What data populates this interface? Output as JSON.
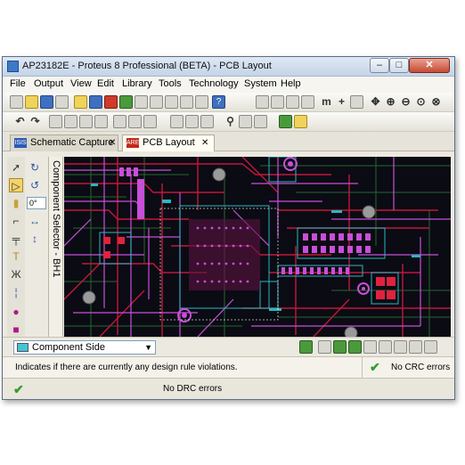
{
  "window": {
    "title": "AP23182E - Proteus 8 Professional (BETA) - PCB Layout",
    "min": "–",
    "max": "□",
    "close": "✕"
  },
  "menu": [
    "File",
    "Output",
    "View",
    "Edit",
    "Library",
    "Tools",
    "Technology",
    "System",
    "Help"
  ],
  "tabs": [
    {
      "icon": "ISIS",
      "label": "Schematic Capture",
      "close": "✕"
    },
    {
      "icon": "ARES",
      "label": "PCB Layout",
      "close": "✕"
    }
  ],
  "rotation": {
    "angle": "0°"
  },
  "selector": {
    "title": "Component Selector - BH1"
  },
  "layer": {
    "value": "Component Side",
    "color": "#43c5d6"
  },
  "status": {
    "message": "Indicates if there are currently any design rule violations.",
    "crc": "No CRC errors",
    "drc": "No DRC errors"
  },
  "toolbar_glyphs": {
    "zoom": "m"
  },
  "colors": {
    "board": "#0b0b14",
    "track_red": "#c2183a",
    "track_magenta": "#c84fd8",
    "track_cyan": "#2bb7c0",
    "track_green": "#2f8f3a"
  }
}
